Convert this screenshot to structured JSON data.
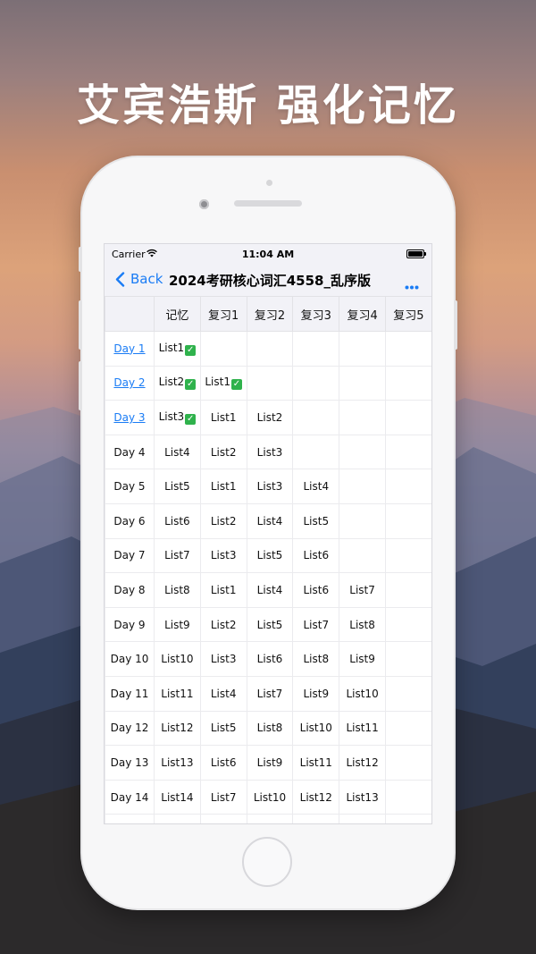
{
  "headline": "艾宾浩斯 强化记忆",
  "status_bar": {
    "carrier": "Carrier",
    "time": "11:04 AM"
  },
  "nav": {
    "back_label": "Back",
    "title": "2024考研核心词汇4558_乱序版"
  },
  "table": {
    "headers": [
      "",
      "记忆",
      "复习1",
      "复习2",
      "复习3",
      "复习4",
      "复习5"
    ],
    "rows": [
      {
        "day": "Day 1",
        "link": true,
        "cells": [
          {
            "t": "List1",
            "c": true
          },
          {
            "t": ""
          },
          {
            "t": ""
          },
          {
            "t": ""
          },
          {
            "t": ""
          },
          {
            "t": ""
          }
        ]
      },
      {
        "day": "Day 2",
        "link": true,
        "cells": [
          {
            "t": "List2",
            "c": true
          },
          {
            "t": "List1",
            "c": true
          },
          {
            "t": ""
          },
          {
            "t": ""
          },
          {
            "t": ""
          },
          {
            "t": ""
          }
        ]
      },
      {
        "day": "Day 3",
        "link": true,
        "cells": [
          {
            "t": "List3",
            "c": true
          },
          {
            "t": "List1"
          },
          {
            "t": "List2"
          },
          {
            "t": ""
          },
          {
            "t": ""
          },
          {
            "t": ""
          }
        ]
      },
      {
        "day": "Day 4",
        "link": false,
        "cells": [
          {
            "t": "List4"
          },
          {
            "t": "List2"
          },
          {
            "t": "List3"
          },
          {
            "t": ""
          },
          {
            "t": ""
          },
          {
            "t": ""
          }
        ]
      },
      {
        "day": "Day 5",
        "link": false,
        "cells": [
          {
            "t": "List5"
          },
          {
            "t": "List1"
          },
          {
            "t": "List3"
          },
          {
            "t": "List4"
          },
          {
            "t": ""
          },
          {
            "t": ""
          }
        ]
      },
      {
        "day": "Day 6",
        "link": false,
        "cells": [
          {
            "t": "List6"
          },
          {
            "t": "List2"
          },
          {
            "t": "List4"
          },
          {
            "t": "List5"
          },
          {
            "t": ""
          },
          {
            "t": ""
          }
        ]
      },
      {
        "day": "Day 7",
        "link": false,
        "cells": [
          {
            "t": "List7"
          },
          {
            "t": "List3"
          },
          {
            "t": "List5"
          },
          {
            "t": "List6"
          },
          {
            "t": ""
          },
          {
            "t": ""
          }
        ]
      },
      {
        "day": "Day 8",
        "link": false,
        "cells": [
          {
            "t": "List8"
          },
          {
            "t": "List1"
          },
          {
            "t": "List4"
          },
          {
            "t": "List6"
          },
          {
            "t": "List7"
          },
          {
            "t": ""
          }
        ]
      },
      {
        "day": "Day 9",
        "link": false,
        "cells": [
          {
            "t": "List9"
          },
          {
            "t": "List2"
          },
          {
            "t": "List5"
          },
          {
            "t": "List7"
          },
          {
            "t": "List8"
          },
          {
            "t": ""
          }
        ]
      },
      {
        "day": "Day 10",
        "link": false,
        "cells": [
          {
            "t": "List10"
          },
          {
            "t": "List3"
          },
          {
            "t": "List6"
          },
          {
            "t": "List8"
          },
          {
            "t": "List9"
          },
          {
            "t": ""
          }
        ]
      },
      {
        "day": "Day 11",
        "link": false,
        "cells": [
          {
            "t": "List11"
          },
          {
            "t": "List4"
          },
          {
            "t": "List7"
          },
          {
            "t": "List9"
          },
          {
            "t": "List10"
          },
          {
            "t": ""
          }
        ]
      },
      {
        "day": "Day 12",
        "link": false,
        "cells": [
          {
            "t": "List12"
          },
          {
            "t": "List5"
          },
          {
            "t": "List8"
          },
          {
            "t": "List10"
          },
          {
            "t": "List11"
          },
          {
            "t": ""
          }
        ]
      },
      {
        "day": "Day 13",
        "link": false,
        "cells": [
          {
            "t": "List13"
          },
          {
            "t": "List6"
          },
          {
            "t": "List9"
          },
          {
            "t": "List11"
          },
          {
            "t": "List12"
          },
          {
            "t": ""
          }
        ]
      },
      {
        "day": "Day 14",
        "link": false,
        "cells": [
          {
            "t": "List14"
          },
          {
            "t": "List7"
          },
          {
            "t": "List10"
          },
          {
            "t": "List12"
          },
          {
            "t": "List13"
          },
          {
            "t": ""
          }
        ]
      },
      {
        "day": "",
        "link": false,
        "cells": [
          {
            "t": ""
          },
          {
            "t": ""
          },
          {
            "t": ""
          },
          {
            "t": ""
          },
          {
            "t": ""
          },
          {
            "t": ""
          }
        ]
      }
    ]
  },
  "colors": {
    "accent": "#1a7cf5",
    "check": "#2fb24c",
    "bar_bg": "#f2f2f7"
  },
  "icons": {
    "back": "chevron-left-icon",
    "more": "ellipsis-icon",
    "wifi": "wifi-icon",
    "battery": "battery-icon",
    "check": "checkmark-box-icon"
  }
}
